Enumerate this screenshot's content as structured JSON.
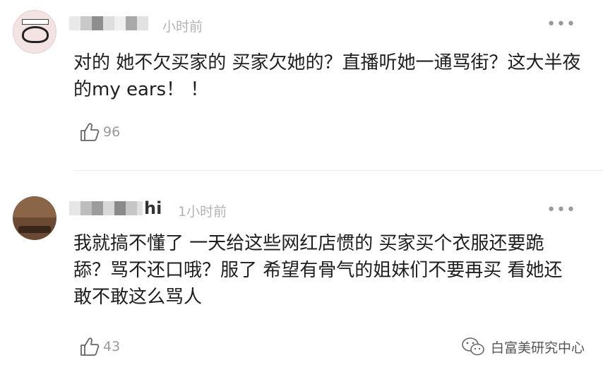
{
  "comments": [
    {
      "name_suffix": "",
      "time": "小时前",
      "more": "•••",
      "text": "对的 她不欠买家的 买家欠她的？直播听她一通骂街？这大半夜的my ears！ ！",
      "likes": "96"
    },
    {
      "name_suffix": "hi",
      "time": "1小时前",
      "more": "•••",
      "text": "我就搞不懂了 一天给这些网红店惯的 买家买个衣服还要跪舔？骂不还口哦？服了 希望有骨气的姐妹们不要再买 看她还敢不敢这么骂人",
      "likes": "43"
    }
  ],
  "watermark": {
    "text": "白富美研究中心",
    "icon": "wechat-icon"
  }
}
